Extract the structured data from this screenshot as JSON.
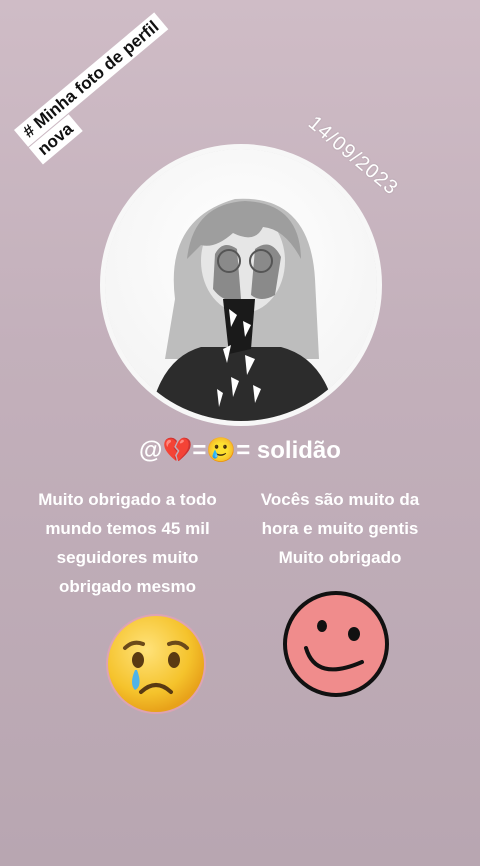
{
  "sticker": {
    "line1": "# Minha foto de perfil",
    "line2": "nova"
  },
  "date": "14/09/2023",
  "profile": {
    "handle": "@💔=🥲= solidão"
  },
  "message_left": {
    "lines": [
      "Muito obrigado a todo",
      "mundo temos 45 mil",
      "seguidores muito",
      "obrigado mesmo"
    ]
  },
  "message_right": {
    "lines": [
      "Vocês são muito da",
      "hora e muito gentis",
      "Muito obrigado"
    ]
  },
  "icons": {
    "sad": "crying-face-emoji-icon",
    "smile": "pink-smiley-face-icon"
  },
  "colors": {
    "background_top": "#cfbcc6",
    "background_bottom": "#b8a6b1",
    "smiley_pink": "#f08c8c",
    "emoji_yellow": "#f5c32c"
  }
}
